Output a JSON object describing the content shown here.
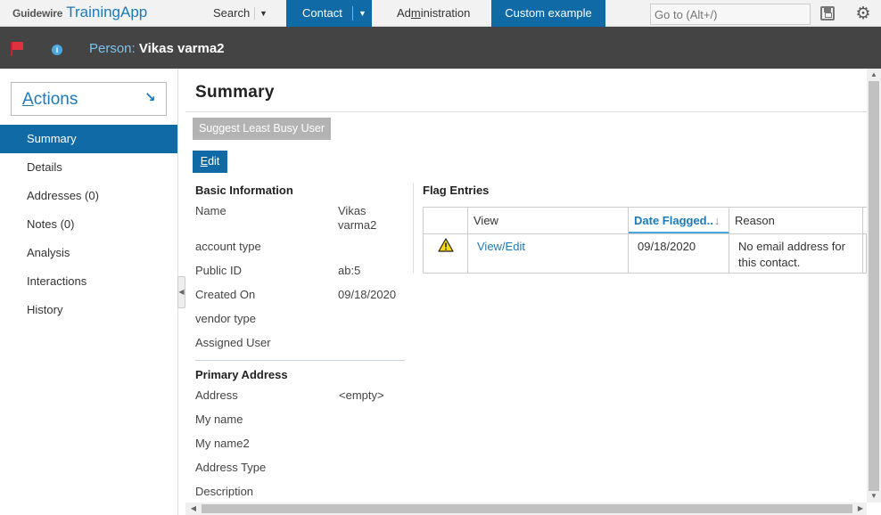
{
  "app": {
    "brand": "Guidewire",
    "name": "TrainingApp"
  },
  "topnav": {
    "search_label": "Search",
    "contact_label": "Contact",
    "admin_label_pre": "Ad",
    "admin_label_mnemonic": "m",
    "admin_label_post": "inistration",
    "custom_label": "Custom example",
    "goto_placeholder": "Go to (Alt+/)"
  },
  "infobar": {
    "person_label": "Person:",
    "person_name": "Vikas varma2"
  },
  "sidebar": {
    "actions_mnemonic": "A",
    "actions_rest": "ctions",
    "items": [
      {
        "label": "Summary",
        "active": true
      },
      {
        "label": "Details"
      },
      {
        "label": "Addresses (0)"
      },
      {
        "label": "Notes (0)"
      },
      {
        "label": "Analysis"
      },
      {
        "label": "Interactions"
      },
      {
        "label": "History"
      }
    ]
  },
  "main": {
    "title": "Summary",
    "suggest_button": "Suggest Least Busy User",
    "edit_mnemonic": "E",
    "edit_rest": "dit",
    "basic_info": {
      "title": "Basic Information",
      "fields": [
        {
          "label": "Name",
          "value_line1": "Vikas",
          "value_line2": "varma2"
        },
        {
          "label": "account type",
          "value": ""
        },
        {
          "label": "Public ID",
          "value": "ab:5"
        },
        {
          "label": "Created On",
          "value": "09/18/2020"
        },
        {
          "label": "vendor type",
          "value": ""
        },
        {
          "label": "Assigned User",
          "value": ""
        }
      ]
    },
    "primary_address": {
      "title": "Primary Address",
      "fields": [
        {
          "label": "Address",
          "value": "<empty>"
        },
        {
          "label": "My name",
          "value": ""
        },
        {
          "label": "My name2",
          "value": ""
        },
        {
          "label": "Address Type",
          "value": ""
        },
        {
          "label": "Description",
          "value": ""
        }
      ]
    },
    "flag_entries": {
      "title": "Flag Entries",
      "columns": [
        "View",
        "Date Flagged..",
        "Reason"
      ],
      "rows": [
        {
          "view": "View/Edit",
          "date": "09/18/2020",
          "reason_line1": "No email address for",
          "reason_line2": "this contact."
        }
      ]
    }
  },
  "colors": {
    "nav_blue": "#0f6aa6",
    "link_blue": "#1d7ab9",
    "infobar": "#444444",
    "flag_red": "#e0313f"
  }
}
